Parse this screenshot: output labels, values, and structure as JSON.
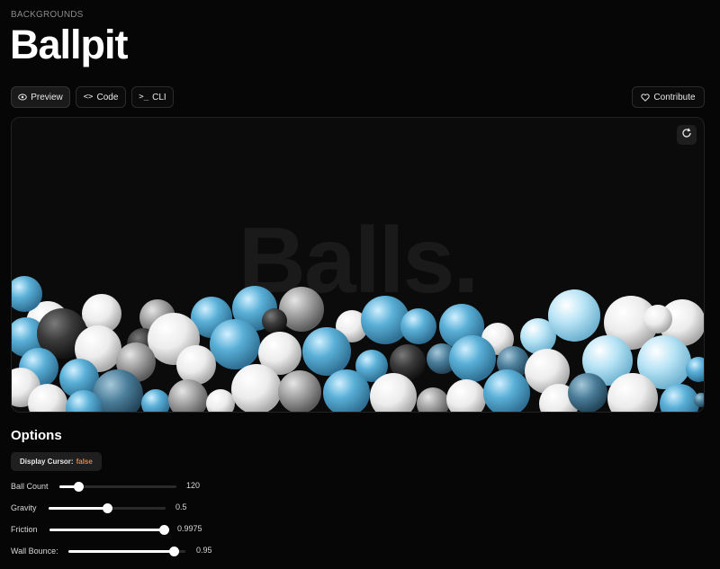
{
  "header": {
    "breadcrumb": "BACKGROUNDS",
    "title": "Ballpit"
  },
  "tabs": [
    {
      "label": "Preview",
      "icon": "eye-icon",
      "active": true
    },
    {
      "label": "Code",
      "icon": "code-icon",
      "active": false
    },
    {
      "label": "CLI",
      "icon": "terminal-icon",
      "active": false
    }
  ],
  "contribute": {
    "label": "Contribute",
    "icon": "heart-icon"
  },
  "preview": {
    "background_text": "Balls.",
    "refresh_icon": "refresh-icon"
  },
  "options": {
    "title": "Options",
    "display_cursor": {
      "label": "Display Cursor:",
      "value": "false"
    },
    "sliders": [
      {
        "label": "Ball Count",
        "value": "120",
        "fraction": 0.16
      },
      {
        "label": "Gravity",
        "value": "0.5",
        "fraction": 0.5
      },
      {
        "label": "Friction",
        "value": "0.9975",
        "fraction": 0.98
      },
      {
        "label": "Wall Bounce:",
        "value": "0.95",
        "fraction": 0.9
      }
    ]
  },
  "colors": {
    "background": "#060606",
    "accent_value": "#e8823a",
    "ball_blue": "#5ab0d8",
    "ball_light_blue": "#a9dbf0",
    "ball_white": "#f2f2f2",
    "ball_grey": "#9a9a9a",
    "ball_dark": "#333333"
  }
}
